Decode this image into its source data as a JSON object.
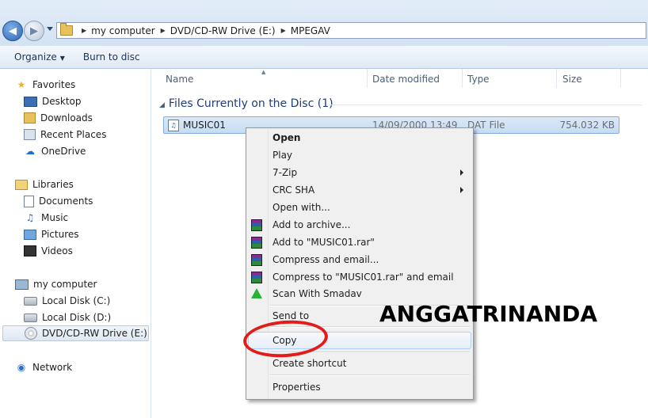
{
  "address": {
    "crumbs": [
      "my computer",
      "DVD/CD-RW Drive (E:)",
      "MPEGAV"
    ]
  },
  "toolbar": {
    "organize_label": "Organize",
    "burn_label": "Burn to disc"
  },
  "sidebar": {
    "favorites": {
      "label": "Favorites",
      "icon": "star-icon"
    },
    "favorite_items": [
      {
        "label": "Desktop",
        "icon": "desktop-icon"
      },
      {
        "label": "Downloads",
        "icon": "downloads-folder-icon"
      },
      {
        "label": "Recent Places",
        "icon": "recent-places-icon"
      },
      {
        "label": "OneDrive",
        "icon": "cloud-icon"
      }
    ],
    "libraries": {
      "label": "Libraries",
      "icon": "library-icon"
    },
    "library_items": [
      {
        "label": "Documents",
        "icon": "documents-icon"
      },
      {
        "label": "Music",
        "icon": "music-note-icon"
      },
      {
        "label": "Pictures",
        "icon": "pictures-icon"
      },
      {
        "label": "Videos",
        "icon": "film-icon"
      }
    ],
    "computer": {
      "label": "my computer",
      "icon": "computer-icon"
    },
    "computer_items": [
      {
        "label": "Local Disk (C:)",
        "icon": "local-disk-icon"
      },
      {
        "label": "Local Disk (D:)",
        "icon": "local-disk-icon"
      },
      {
        "label": "DVD/CD-RW Drive (E:)",
        "icon": "dvd-drive-icon",
        "selected": true
      }
    ],
    "network": {
      "label": "Network",
      "icon": "network-icon"
    }
  },
  "columns": {
    "name": "Name",
    "date_modified": "Date modified",
    "type": "Type",
    "size": "Size"
  },
  "group": {
    "title": "Files Currently on the Disc (1)"
  },
  "file": {
    "name": "MUSIC01",
    "date": "14/09/2000 13:49",
    "type": "DAT File",
    "size": "754.032 KB",
    "icon": "dat-file-icon"
  },
  "context_menu": {
    "items": {
      "open": "Open",
      "play": "Play",
      "seven_zip": "7-Zip",
      "crc_sha": "CRC SHA",
      "open_with": "Open with...",
      "add_archive": "Add to archive...",
      "add_rar": "Add to \"MUSIC01.rar\"",
      "compress_email": "Compress and email...",
      "compress_rar_email": "Compress to \"MUSIC01.rar\" and email",
      "scan_smadav": "Scan With Smadav",
      "send_to": "Send to",
      "copy": "Copy",
      "create_shortcut": "Create shortcut",
      "properties": "Properties"
    }
  },
  "overlay": {
    "watermark": "ANGGATRINANDA",
    "highlight_color": "#e21b1b"
  }
}
